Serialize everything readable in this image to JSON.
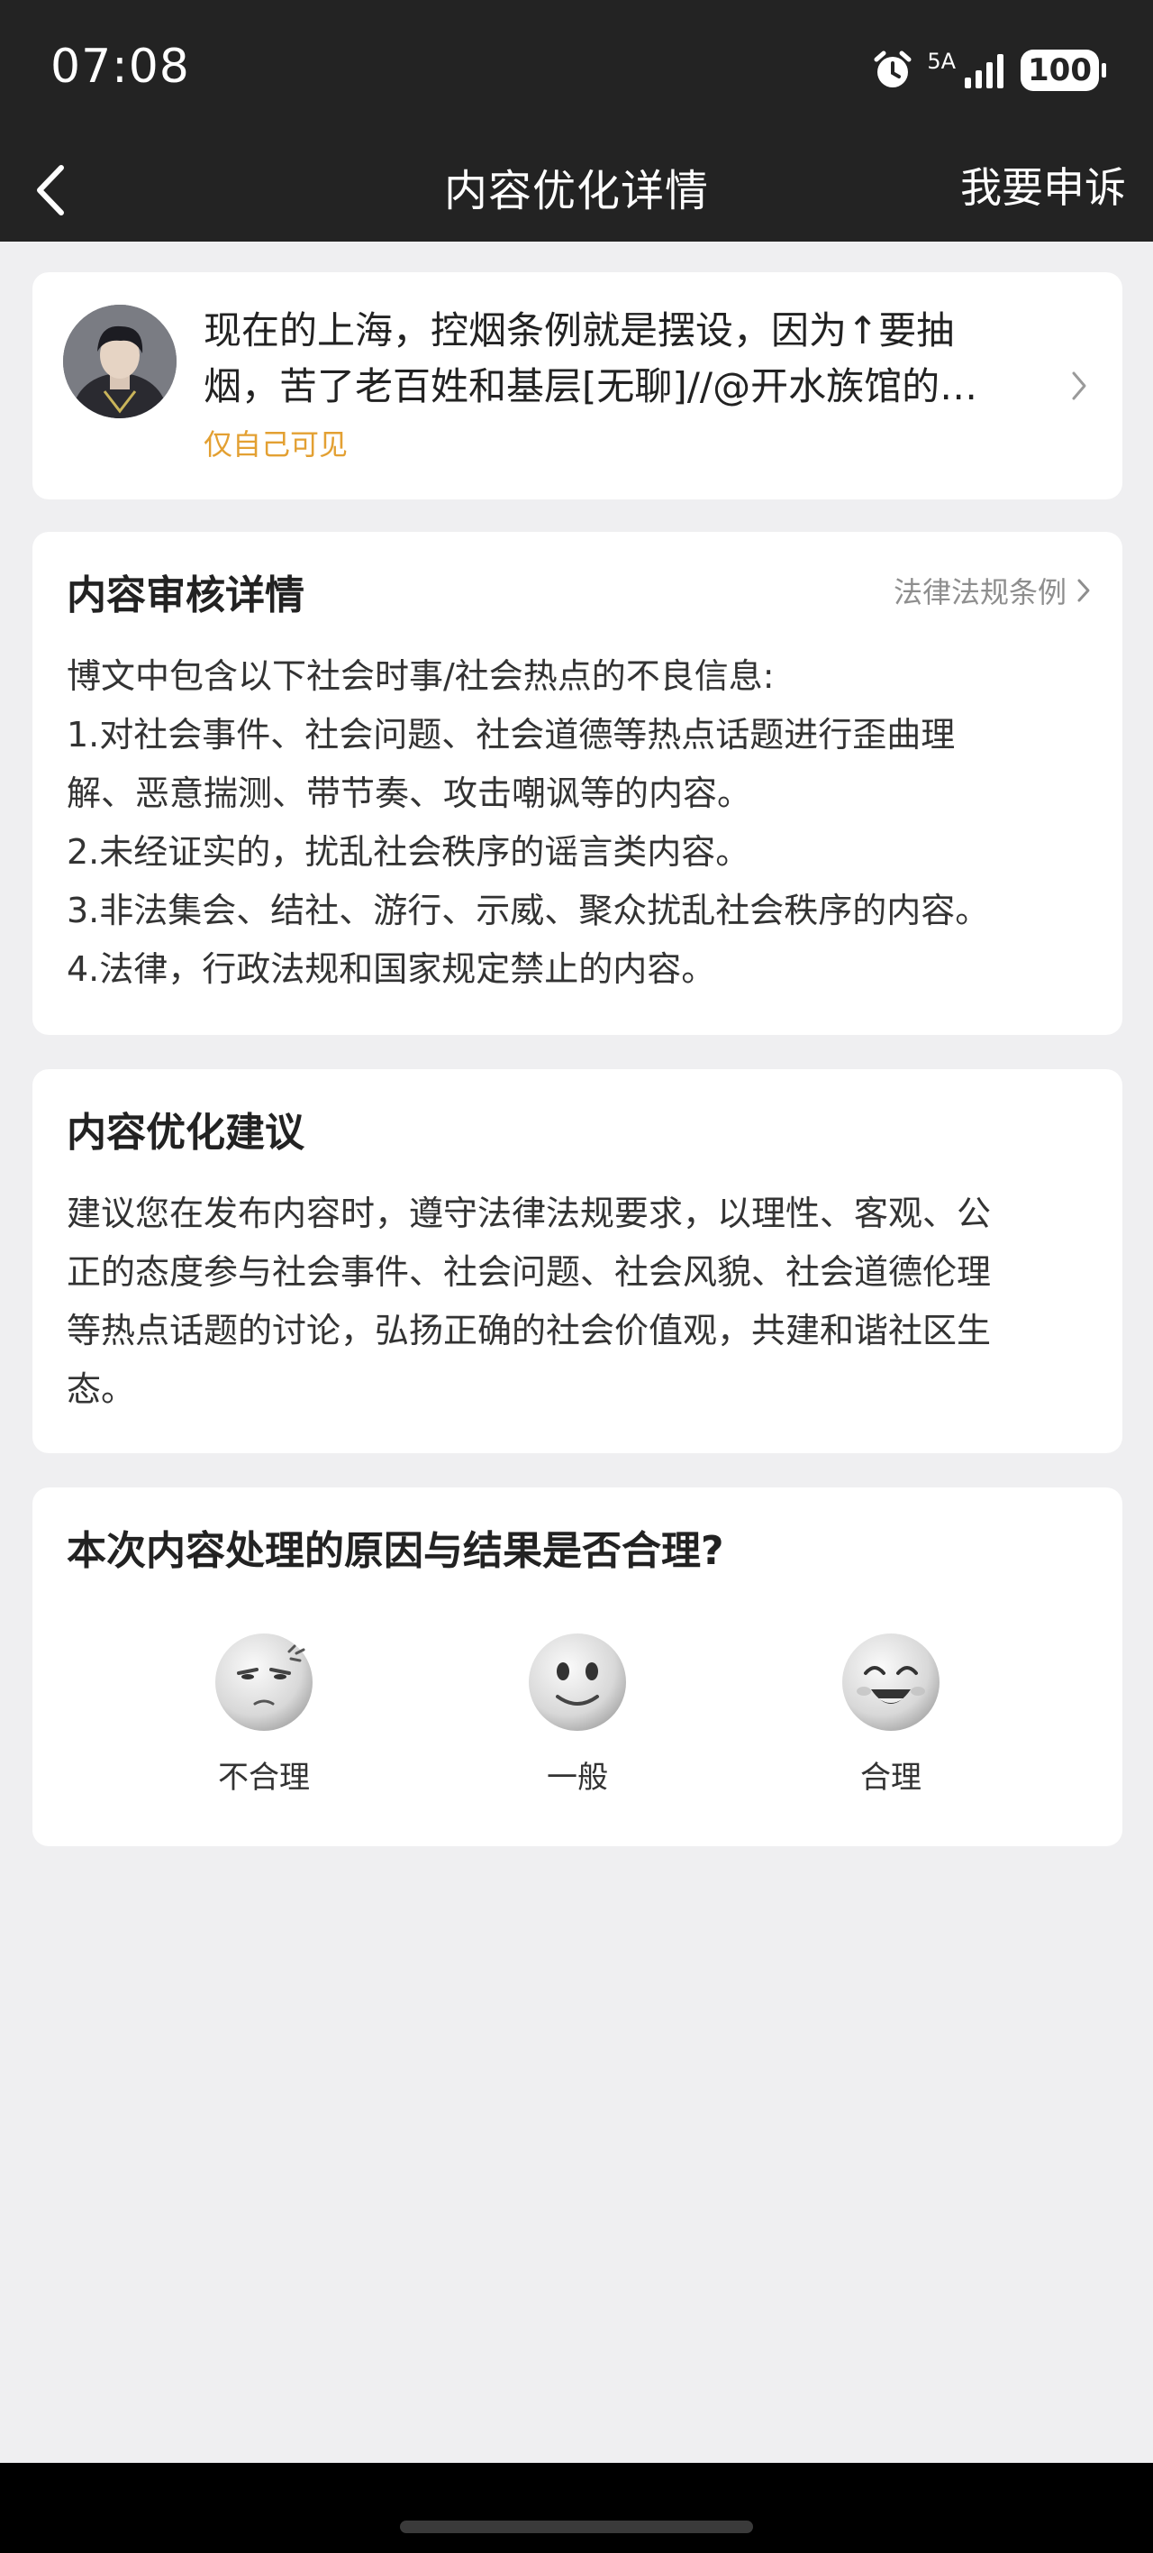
{
  "status_bar": {
    "time": "07:08",
    "network": "5A",
    "battery": "100"
  },
  "nav": {
    "title": "内容优化详情",
    "action": "我要申诉"
  },
  "post": {
    "line1": "现在的上海，控烟条例就是摆设，因为↑要抽",
    "line2": "烟，苦了老百姓和基层[无聊]//@开水族馆的…",
    "visibility": "仅自己可见"
  },
  "review": {
    "title": "内容审核详情",
    "link": "法律法规条例",
    "lines": [
      "博文中包含以下社会时事/社会热点的不良信息:",
      "1.对社会事件、社会问题、社会道德等热点话题进行歪曲理",
      "解、恶意揣测、带节奏、攻击嘲讽等的内容。",
      "2.未经证实的，扰乱社会秩序的谣言类内容。",
      "3.非法集会、结社、游行、示威、聚众扰乱社会秩序的内容。",
      "4.法律，行政法规和国家规定禁止的内容。"
    ]
  },
  "advice": {
    "title": "内容优化建议",
    "lines": [
      "建议您在发布内容时，遵守法律法规要求，以理性、客观、公",
      "正的态度参与社会事件、社会问题、社会风貌、社会道德伦理",
      "等热点话题的讨论，弘扬正确的社会价值观，共建和谐社区生",
      "态。"
    ]
  },
  "feedback": {
    "question": "本次内容处理的原因与结果是否合理?",
    "options": [
      {
        "label": "不合理",
        "icon": "annoyed-face-icon"
      },
      {
        "label": "一般",
        "icon": "neutral-face-icon"
      },
      {
        "label": "合理",
        "icon": "happy-face-icon"
      }
    ]
  },
  "colors": {
    "accent_orange": "#e3a032",
    "dark_bar": "#232323",
    "page_bg": "#efeff1"
  }
}
